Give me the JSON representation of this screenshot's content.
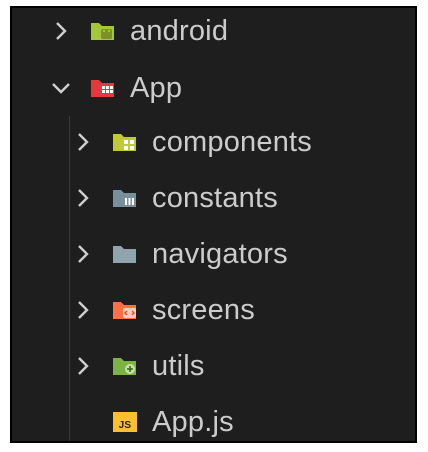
{
  "explorer": {
    "items": [
      {
        "label": "android",
        "icon": "android-folder-icon",
        "expanded": false,
        "color": "#a4c639"
      },
      {
        "label": "App",
        "icon": "app-folder-icon",
        "expanded": true,
        "color": "#e53935"
      },
      {
        "label": "components",
        "icon": "components-folder-icon",
        "expanded": false,
        "color": "#c0ca33"
      },
      {
        "label": "constants",
        "icon": "constants-folder-icon",
        "expanded": false,
        "color": "#78909c"
      },
      {
        "label": "navigators",
        "icon": "folder-icon",
        "expanded": false,
        "color": "#90a4ae"
      },
      {
        "label": "screens",
        "icon": "screens-folder-icon",
        "expanded": false,
        "color": "#ff7043"
      },
      {
        "label": "utils",
        "icon": "utils-folder-icon",
        "expanded": false,
        "color": "#7cb342"
      },
      {
        "label": "App.js",
        "icon": "js-file-icon",
        "color": "#fbc02d",
        "badge": "JS"
      }
    ]
  }
}
